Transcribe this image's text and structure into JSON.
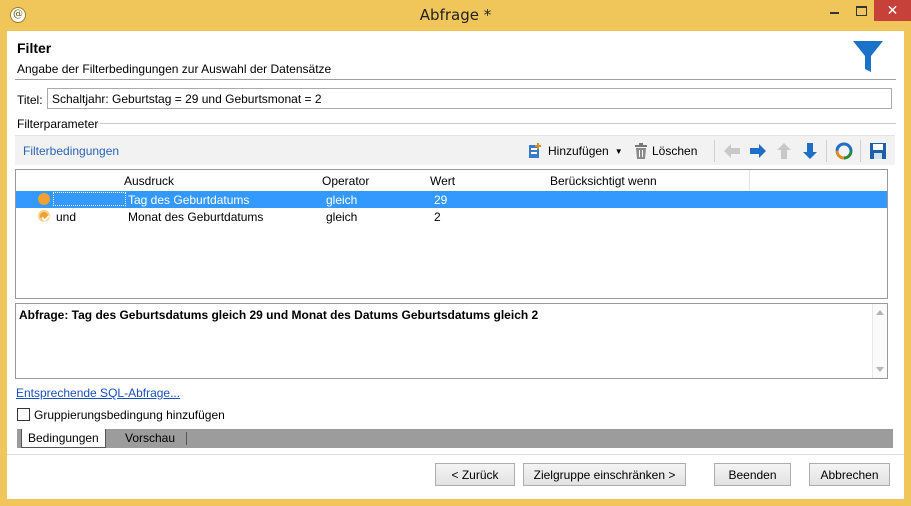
{
  "window": {
    "title": "Abfrage *",
    "icon": "app-icon"
  },
  "header": {
    "title": "Filter",
    "subtitle": "Angabe der Filterbedingungen zur Auswahl der Datensätze",
    "icon": "funnel-icon"
  },
  "title_field": {
    "label": "Titel:",
    "value": "Schaltjahr: Geburtstag = 29 und Geburtsmonat = 2"
  },
  "filter_section": {
    "label": "Filterparameter"
  },
  "toolbar": {
    "link": "Filterbedingungen",
    "add_label": "Hinzufügen",
    "delete_label": "Löschen"
  },
  "grid": {
    "columns": [
      "Ausdruck",
      "Operator",
      "Wert",
      "Berücksichtigt wenn"
    ],
    "rows": [
      {
        "prefix": "",
        "expression": "Tag des Geburtdatums",
        "operator": "gleich",
        "value": "29",
        "condition": "",
        "selected": true
      },
      {
        "prefix": "und",
        "expression": "Monat des Geburtdatums",
        "operator": "gleich",
        "value": "2",
        "condition": "",
        "selected": false
      }
    ]
  },
  "query_text": "Abfrage: Tag des Geburtsdatums gleich 29 und Monat des Datums Geburtsdatums gleich 2",
  "sql_link": "Entsprechende SQL-Abfrage...",
  "group_checkbox": {
    "label": "Gruppierungsbedingung hinzufügen",
    "checked": false
  },
  "tabs": [
    "Bedingungen",
    "Vorschau"
  ],
  "buttons": {
    "back": "< Zurück",
    "next": "Zielgruppe einschränken >",
    "finish": "Beenden",
    "cancel": "Abbrechen"
  },
  "colors": {
    "accent": "#3399ff",
    "link": "#2a64b8",
    "funnel": "#1a73c8",
    "close": "#c7403a"
  }
}
